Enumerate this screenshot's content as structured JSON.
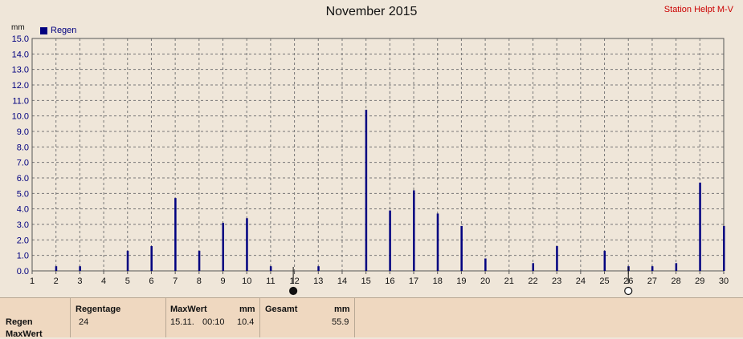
{
  "header": {
    "title": "November 2015",
    "station": "Station Helpt M-V"
  },
  "chart_data": {
    "type": "bar",
    "title": "November 2015",
    "ylabel": "mm",
    "xlim": [
      1,
      30
    ],
    "ylim": [
      0,
      15
    ],
    "grid": true,
    "legend": "top-left",
    "x_ticks": [
      "1",
      "2",
      "3",
      "4",
      "5",
      "6",
      "7",
      "8",
      "9",
      "10",
      "11",
      "12",
      "13",
      "14",
      "15",
      "16",
      "17",
      "18",
      "19",
      "20",
      "21",
      "22",
      "23",
      "24",
      "25",
      "26",
      "27",
      "28",
      "29",
      "30"
    ],
    "y_ticks": [
      "0.0",
      "1.0",
      "2.0",
      "3.0",
      "4.0",
      "5.0",
      "6.0",
      "7.0",
      "8.0",
      "9.0",
      "10.0",
      "11.0",
      "12.0",
      "13.0",
      "14.0",
      "15.0"
    ],
    "series": [
      {
        "name": "Regen",
        "color": "#000080",
        "x": [
          2,
          3,
          5,
          6,
          7,
          8,
          9,
          10,
          11,
          13,
          15,
          16,
          17,
          18,
          19,
          20,
          22,
          23,
          25,
          26,
          27,
          28,
          29,
          30
        ],
        "values": [
          0.3,
          0.3,
          1.3,
          1.6,
          4.7,
          1.3,
          3.1,
          3.4,
          0.3,
          0.3,
          10.4,
          3.9,
          5.2,
          3.7,
          2.9,
          0.8,
          0.5,
          1.6,
          1.3,
          0.3,
          0.3,
          0.5,
          5.7,
          2.9
        ]
      }
    ],
    "moon_phases": [
      {
        "x": 11.95,
        "phase": "new-moon"
      },
      {
        "x": 26.0,
        "phase": "full-moon"
      }
    ]
  },
  "legend": {
    "label": "Regen"
  },
  "stats": {
    "row_label": "Regen",
    "row_label2": "MaxWert",
    "regentage_label": "Regentage",
    "regentage_value": "24",
    "maxwert_label": "MaxWert",
    "maxwert_unit": "mm",
    "maxwert_date": "15.11.",
    "maxwert_time": "00:10",
    "maxwert_value": "10.4",
    "gesamt_label": "Gesamt",
    "gesamt_unit": "mm",
    "gesamt_value": "55.9"
  }
}
